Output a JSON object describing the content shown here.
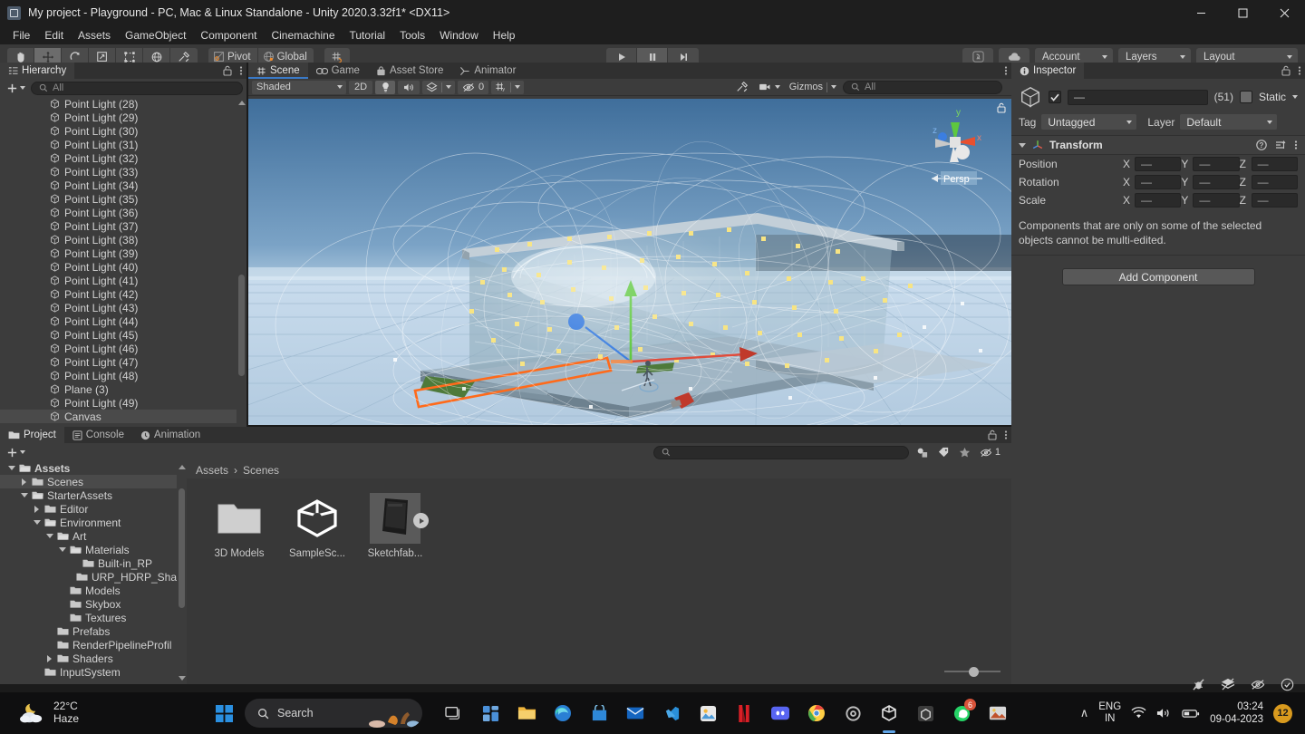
{
  "window": {
    "title": "My project - Playground - PC, Mac & Linux Standalone - Unity 2020.3.32f1* <DX11>",
    "icon": "unity-app-icon",
    "minimize": "─",
    "maximize": "☐",
    "close": "✕"
  },
  "menubar": {
    "items": [
      "File",
      "Edit",
      "Assets",
      "GameObject",
      "Component",
      "Cinemachine",
      "Tutorial",
      "Tools",
      "Window",
      "Help"
    ]
  },
  "toolbar": {
    "tools": [
      {
        "name": "hand-tool",
        "glyph": "✋"
      },
      {
        "name": "move-tool",
        "glyph": "✥"
      },
      {
        "name": "rotate-tool",
        "glyph": "↻"
      },
      {
        "name": "scale-tool",
        "glyph": "⤢"
      },
      {
        "name": "rect-tool",
        "glyph": "⬚"
      },
      {
        "name": "transform-tool",
        "glyph": "◎"
      },
      {
        "name": "custom-tool",
        "glyph": "⚒"
      }
    ],
    "pivot_label": "Pivot",
    "global_label": "Global",
    "grid_snap": "grid-snap-icon",
    "play_label": "Play",
    "pause_label": "Pause",
    "step_label": "Step",
    "collab_label": "collab-icon",
    "cloud_label": "cloud-icon",
    "account_label": "Account",
    "layers_label": "Layers",
    "layout_label": "Layout"
  },
  "hierarchy": {
    "tab_label": "Hierarchy",
    "tab_icon": "hierarchy-icon",
    "lock_icon": "lock-icon",
    "menu_icon": "kebab-menu-icon",
    "create_label": "+",
    "search_placeholder": "All",
    "items": [
      {
        "label": "Point Light (28)",
        "selected": false
      },
      {
        "label": "Point Light (29)",
        "selected": false
      },
      {
        "label": "Point Light (30)",
        "selected": false
      },
      {
        "label": "Point Light (31)",
        "selected": false
      },
      {
        "label": "Point Light (32)",
        "selected": false
      },
      {
        "label": "Point Light (33)",
        "selected": false
      },
      {
        "label": "Point Light (34)",
        "selected": false
      },
      {
        "label": "Point Light (35)",
        "selected": false
      },
      {
        "label": "Point Light (36)",
        "selected": false
      },
      {
        "label": "Point Light (37)",
        "selected": false
      },
      {
        "label": "Point Light (38)",
        "selected": false
      },
      {
        "label": "Point Light (39)",
        "selected": false
      },
      {
        "label": "Point Light (40)",
        "selected": false
      },
      {
        "label": "Point Light (41)",
        "selected": false
      },
      {
        "label": "Point Light (42)",
        "selected": false
      },
      {
        "label": "Point Light (43)",
        "selected": false
      },
      {
        "label": "Point Light (44)",
        "selected": false
      },
      {
        "label": "Point Light (45)",
        "selected": false
      },
      {
        "label": "Point Light (46)",
        "selected": false
      },
      {
        "label": "Point Light (47)",
        "selected": false
      },
      {
        "label": "Point Light (48)",
        "selected": false
      },
      {
        "label": "Plane (3)",
        "selected": false
      },
      {
        "label": "Point Light (49)",
        "selected": false
      },
      {
        "label": "Canvas",
        "selected": true
      }
    ]
  },
  "scene": {
    "tabs": [
      {
        "label": "Scene",
        "icon": "scene-grid-icon",
        "active": true
      },
      {
        "label": "Game",
        "icon": "gamepad-icon",
        "active": false
      },
      {
        "label": "Asset Store",
        "icon": "store-bag-icon",
        "active": false
      },
      {
        "label": "Animator",
        "icon": "animator-icon",
        "active": false
      }
    ],
    "menu_icon": "kebab-menu-icon",
    "draw_mode": "Shaded",
    "mode_2d": "2D",
    "lighting_icon": "lightbulb-icon",
    "audio_icon": "speaker-icon",
    "fx_icon": "fx-icon",
    "hidden_count": "0",
    "grid_icon": "grid-y-icon",
    "tools_icon": "tools-icon",
    "camera_icon": "camera-icon",
    "gizmos_label": "Gizmos",
    "search_placeholder": "All",
    "gizmo": {
      "x_label": "x",
      "y_label": "y",
      "z_label": "z",
      "projection_label": "Persp"
    }
  },
  "inspector": {
    "tab_label": "Inspector",
    "tab_icon": "info-icon",
    "lock_icon": "lock-icon",
    "menu_icon": "kebab-menu-icon",
    "object_icon": "cube-icon",
    "enabled_checked": true,
    "name_value": "—",
    "multi_count": "(51)",
    "static_label": "Static",
    "tag_label": "Tag",
    "tag_value": "Untagged",
    "layer_label": "Layer",
    "layer_value": "Default",
    "component": {
      "title": "Transform",
      "icon": "transform-axis-icon",
      "help_icon": "help-icon",
      "preset_icon": "preset-icon",
      "menu_icon": "kebab-menu-icon",
      "rows": [
        {
          "label": "Position",
          "x": "—",
          "y": "—",
          "z": "—"
        },
        {
          "label": "Rotation",
          "x": "—",
          "y": "—",
          "z": "—"
        },
        {
          "label": "Scale",
          "x": "—",
          "y": "—",
          "z": "—"
        }
      ],
      "axis_x": "X",
      "axis_y": "Y",
      "axis_z": "Z"
    },
    "note": "Components that are only on some of the selected objects cannot be multi-edited.",
    "add_component_label": "Add Component"
  },
  "project": {
    "tabs": [
      {
        "label": "Project",
        "icon": "folder-icon",
        "active": true
      },
      {
        "label": "Console",
        "icon": "console-icon",
        "active": false
      },
      {
        "label": "Animation",
        "icon": "clock-icon",
        "active": false
      }
    ],
    "lock_icon": "lock-icon",
    "menu_icon": "kebab-menu-icon",
    "create_label": "+",
    "search_placeholder": "",
    "filter_icons": [
      "package-filter-icon",
      "label-filter-icon",
      "favorite-filter-icon",
      "hidden-filter-icon"
    ],
    "hidden_count": "1",
    "tree": [
      {
        "label": "Assets",
        "depth": 0,
        "arrow": "down",
        "open": true,
        "selected": false,
        "bold": true
      },
      {
        "label": "Scenes",
        "depth": 1,
        "arrow": "right",
        "open": false,
        "selected": true
      },
      {
        "label": "StarterAssets",
        "depth": 1,
        "arrow": "down",
        "open": true,
        "selected": false
      },
      {
        "label": "Editor",
        "depth": 2,
        "arrow": "right",
        "open": false,
        "selected": false
      },
      {
        "label": "Environment",
        "depth": 2,
        "arrow": "down",
        "open": true,
        "selected": false
      },
      {
        "label": "Art",
        "depth": 3,
        "arrow": "down",
        "open": true,
        "selected": false
      },
      {
        "label": "Materials",
        "depth": 4,
        "arrow": "down",
        "open": true,
        "selected": false
      },
      {
        "label": "Built-in_RP",
        "depth": 5,
        "arrow": "none",
        "open": false,
        "selected": false
      },
      {
        "label": "URP_HDRP_Sha",
        "depth": 5,
        "arrow": "none",
        "open": false,
        "selected": false
      },
      {
        "label": "Models",
        "depth": 4,
        "arrow": "none",
        "open": false,
        "selected": false
      },
      {
        "label": "Skybox",
        "depth": 4,
        "arrow": "none",
        "open": false,
        "selected": false
      },
      {
        "label": "Textures",
        "depth": 4,
        "arrow": "none",
        "open": false,
        "selected": false
      },
      {
        "label": "Prefabs",
        "depth": 3,
        "arrow": "none",
        "open": false,
        "selected": false
      },
      {
        "label": "RenderPipelineProfil",
        "depth": 3,
        "arrow": "none",
        "open": false,
        "selected": false
      },
      {
        "label": "Shaders",
        "depth": 3,
        "arrow": "right",
        "open": false,
        "selected": false
      },
      {
        "label": "InputSystem",
        "depth": 2,
        "arrow": "none",
        "open": false,
        "selected": false
      }
    ],
    "breadcrumb": [
      "Assets",
      "Scenes"
    ],
    "breadcrumb_separator": "›",
    "assets": [
      {
        "label": "3D Models",
        "kind": "folder",
        "selected": false
      },
      {
        "label": "SampleSc...",
        "kind": "unity-scene",
        "selected": false
      },
      {
        "label": "Sketchfab...",
        "kind": "model-preview",
        "selected": true
      }
    ]
  },
  "taskbar": {
    "weather": {
      "temperature": "22°C",
      "condition": "Haze",
      "icon": "night-cloud-icon"
    },
    "start_label": "start-button",
    "search_placeholder": "Search",
    "apps": [
      {
        "name": "task-view-icon",
        "badge": null
      },
      {
        "name": "widgets-icon",
        "badge": null
      },
      {
        "name": "file-explorer-icon",
        "badge": null
      },
      {
        "name": "edge-browser-icon",
        "badge": null
      },
      {
        "name": "store-icon",
        "badge": null
      },
      {
        "name": "mail-icon",
        "badge": null
      },
      {
        "name": "vscode-icon",
        "badge": null
      },
      {
        "name": "photos-icon",
        "badge": null
      },
      {
        "name": "netflix-icon",
        "badge": null
      },
      {
        "name": "discord-icon",
        "badge": null
      },
      {
        "name": "chrome-icon",
        "badge": null
      },
      {
        "name": "settings-icon",
        "badge": null
      },
      {
        "name": "unity-icon",
        "badge": null
      },
      {
        "name": "unity-hub-icon",
        "badge": null
      },
      {
        "name": "whatsapp-icon",
        "badge": "6"
      },
      {
        "name": "gallery-icon",
        "badge": null
      }
    ],
    "chevron": "∧",
    "language": {
      "line1": "ENG",
      "line2": "IN"
    },
    "wifi_icon": "wifi-icon",
    "volume_icon": "volume-icon",
    "battery_icon": "battery-icon",
    "time": "03:24",
    "date": "09-04-2023",
    "notification_count": "12"
  },
  "statusbar": {
    "icons": [
      "bug-mute-icon",
      "layers-icon",
      "eye-off-icon",
      "check-circle-icon"
    ]
  },
  "colors": {
    "accent_blue": "#3a79c6",
    "selection_orange": "#ff6a1a",
    "axis_x": "#e04c3b",
    "axis_y": "#5ec83f",
    "axis_z": "#3b7ee0",
    "panel_bg": "#3c3c3c",
    "toolbar_bg": "#393939",
    "titlebar_bg": "#1e1e1e",
    "light_gizmo_yellow": "#f5e27a"
  }
}
